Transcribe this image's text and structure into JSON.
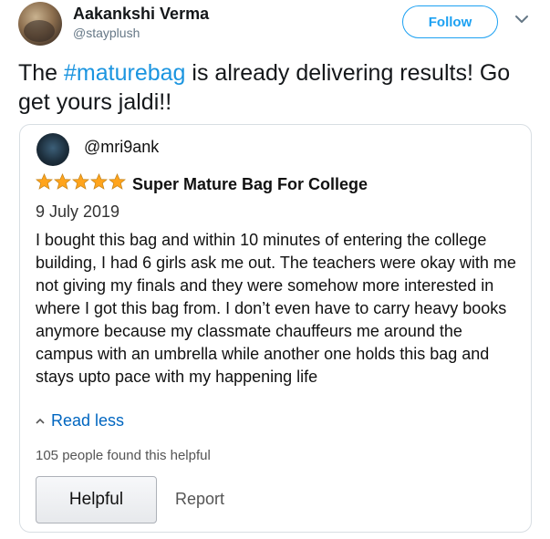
{
  "tweet": {
    "author_name": "Aakankshi Verma",
    "author_handle": "@stayplush",
    "follow_label": "Follow",
    "text_before": "The ",
    "hashtag": "#maturebag",
    "text_after": " is already delivering results! Go get yours jaldi!!"
  },
  "review": {
    "reviewer_handle": "@mri9ank",
    "rating_stars": 5,
    "title": "Super Mature Bag For College",
    "date": "9 July 2019",
    "body": "I bought this bag and within 10 minutes of entering the college building, I had 6 girls ask me out. The teachers were okay with me not giving my finals and they were somehow more interested in where I got this bag from. I don’t even have to carry heavy books anymore because my classmate chauffeurs me around the campus with an umbrella while another one holds this bag and stays upto pace with my happening life",
    "read_less_label": "Read less",
    "helpful_count_text": "105 people found this helpful",
    "helpful_button_label": "Helpful",
    "report_label": "Report"
  },
  "colors": {
    "twitter_blue": "#1da1f2",
    "hashtag_blue": "#1b95e0",
    "star_orange": "#ffa41c",
    "link_blue": "#0066c0"
  },
  "icons": {
    "menu": "chevron-down-icon",
    "star": "star-icon",
    "read_less": "chevron-up-icon"
  }
}
